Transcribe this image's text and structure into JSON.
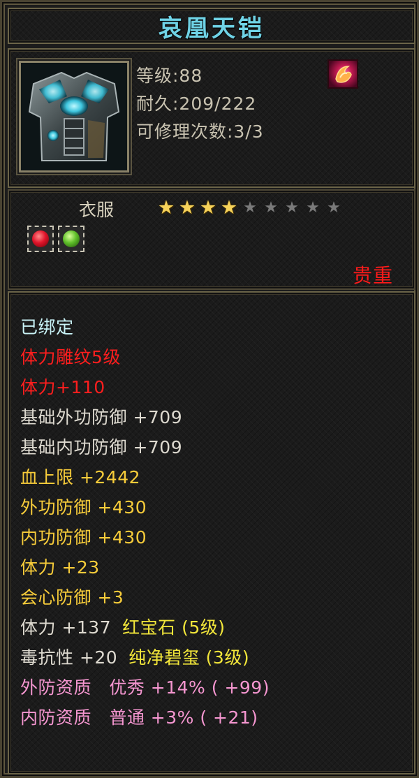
{
  "item": {
    "name": "哀凰天铠",
    "level_text": "等级:88",
    "durability_text": "耐久:209/222",
    "repair_text": "可修理次数:3/3",
    "category": "衣服",
    "stars_filled": 4,
    "stars_total": 9,
    "rarity": "贵重"
  },
  "icons": {
    "portrait": "armor-portrait",
    "badge": "rune-badge-icon",
    "gems": [
      "red-gem-icon",
      "green-gem-icon"
    ]
  },
  "attributes": [
    {
      "text": "已绑定",
      "color": "#c9f3f7"
    },
    {
      "text": "体力雕纹5级",
      "color": "#ff1e1e"
    },
    {
      "text": "体力+110",
      "color": "#ff1e1e"
    },
    {
      "text": "基础外功防御 +709",
      "color": "#dedad0"
    },
    {
      "text": "基础内功防御 +709",
      "color": "#dedad0"
    },
    {
      "text": "血上限 +2442",
      "color": "#f7cc3a"
    },
    {
      "text": "外功防御 +430",
      "color": "#f7cc3a"
    },
    {
      "text": "内功防御 +430",
      "color": "#f7cc3a"
    },
    {
      "text": "体力 +23",
      "color": "#f7cc3a"
    },
    {
      "text": "会心防御 +3",
      "color": "#f7cc3a"
    },
    {
      "text": "体力 +137",
      "gem": "红宝石 (5级)",
      "color": "#dedad0"
    },
    {
      "text": "毒抗性 +20",
      "gem": "纯净碧玺 (3级)",
      "color": "#dedad0"
    },
    {
      "text": "外防资质   优秀 +14% ( +99)",
      "color": "#f596d0"
    },
    {
      "text": "内防资质   普通 +3% ( +21)",
      "color": "#f596d0"
    }
  ]
}
